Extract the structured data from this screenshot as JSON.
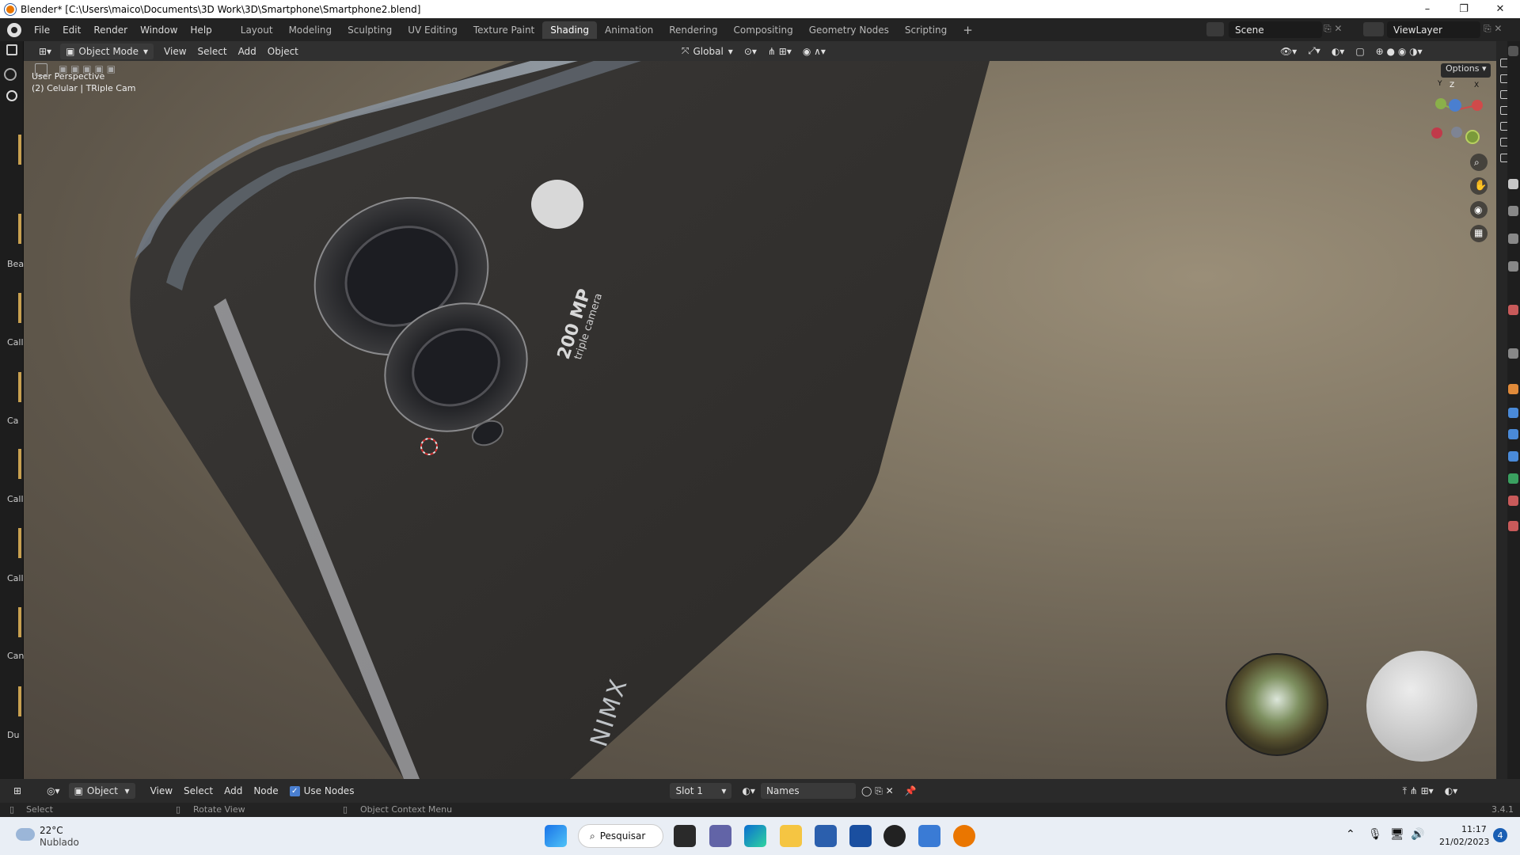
{
  "window": {
    "title": "Blender* [C:\\Users\\maico\\Documents\\3D Work\\3D\\Smartphone\\Smartphone2.blend]",
    "controls": [
      "–",
      "❐",
      "✕"
    ]
  },
  "menubar": {
    "menus": [
      "File",
      "Edit",
      "Render",
      "Window",
      "Help"
    ],
    "workspaces": [
      "Layout",
      "Modeling",
      "Sculpting",
      "UV Editing",
      "Texture Paint",
      "Shading",
      "Animation",
      "Rendering",
      "Compositing",
      "Geometry Nodes",
      "Scripting"
    ],
    "active_workspace": "Shading",
    "add_tab": "+",
    "scene": "Scene",
    "view_layer": "ViewLayer"
  },
  "viewport_header": {
    "mode": "Object Mode",
    "menus": [
      "View",
      "Select",
      "Add",
      "Object"
    ],
    "orientation": "Global",
    "options": "Options"
  },
  "viewport": {
    "perspective_label": "User Perspective",
    "object_label": "(2) Celular | TRiple Cam",
    "phone_text_main": "200 MP",
    "phone_text_sub": "triple camera",
    "brand_text": "NIMX",
    "gizmo": {
      "y": "Y",
      "z": "Z",
      "x": "X"
    }
  },
  "left_sidebar": {
    "labels": [
      "Bea",
      "Call",
      "Ca",
      "Call",
      "Call",
      "Can",
      "Du"
    ]
  },
  "node_header": {
    "editor": "Object",
    "menus": [
      "View",
      "Select",
      "Add",
      "Node"
    ],
    "use_nodes_label": "Use Nodes",
    "use_nodes_checked": true,
    "slot": "Slot 1",
    "material_name": "Names"
  },
  "statusbar": {
    "select": "Select",
    "rotate": "Rotate View",
    "context": "Object Context Menu",
    "version": "3.4.1"
  },
  "taskbar": {
    "weather_temp": "22°C",
    "weather_desc": "Nublado",
    "search_label": "Pesquisar",
    "time": "11:17",
    "date": "21/02/2023",
    "notification_count": "4"
  }
}
